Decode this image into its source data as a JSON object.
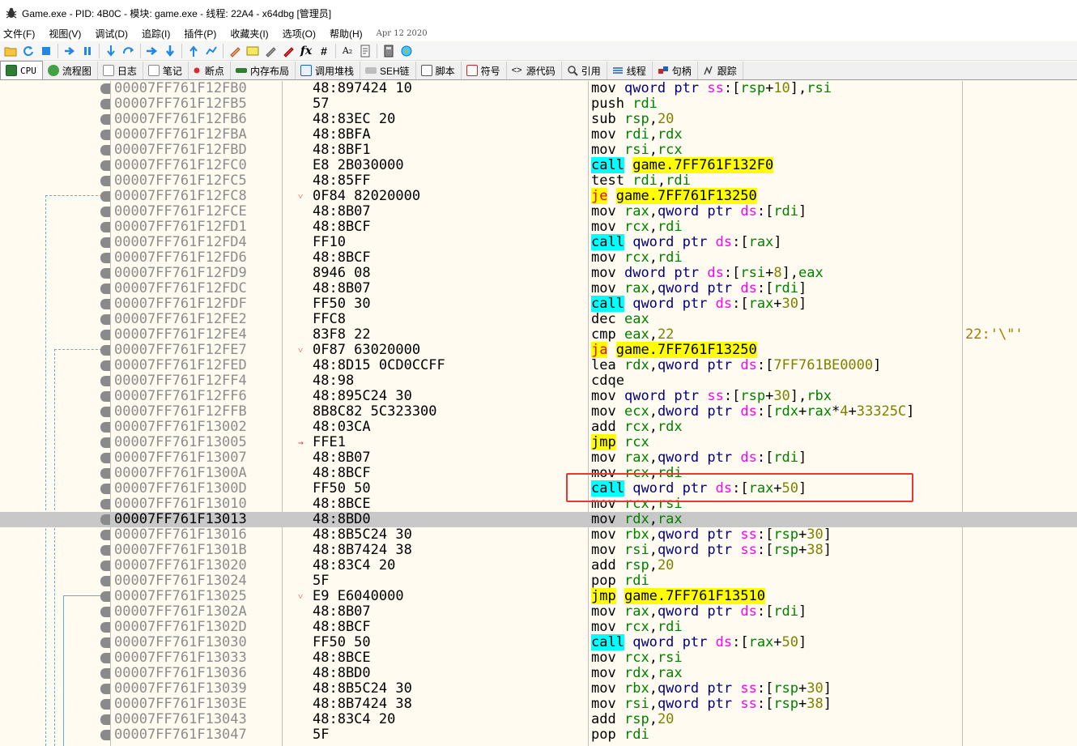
{
  "window": {
    "title": "Game.exe - PID: 4B0C - 模块: game.exe - 线程: 22A4 - x64dbg [管理员]"
  },
  "menu": {
    "items": [
      "文件(F)",
      "视图(V)",
      "调试(D)",
      "追踪(I)",
      "插件(P)",
      "收藏夹(I)",
      "选项(O)",
      "帮助(H)"
    ],
    "date": "Apr 12 2020"
  },
  "toolbar": {
    "icons": [
      "open-icon",
      "restart-icon",
      "stop-icon",
      "run-icon",
      "pause-icon",
      "step-into-icon",
      "step-over-icon",
      "trace-into-icon",
      "trace-over-icon",
      "execute-till-return-icon",
      "run-to-user-code-icon",
      "comment-icon",
      "label-icon",
      "bookmark-icon",
      "function-icon",
      "fx-icon",
      "hash-icon",
      "font-icon",
      "script-icon",
      "calculator-icon",
      "help-icon"
    ]
  },
  "tabs": [
    {
      "label": "CPU",
      "icon": "cpu-icon",
      "color": "#2e7d32",
      "active": true
    },
    {
      "label": "流程图",
      "icon": "graph-icon",
      "color": "#388e3c"
    },
    {
      "label": "日志",
      "icon": "log-icon",
      "color": "#999999"
    },
    {
      "label": "笔记",
      "icon": "notes-icon",
      "color": "#999999"
    },
    {
      "label": "断点",
      "icon": "breakpoint-icon",
      "color": "#d32f2f"
    },
    {
      "label": "内存布局",
      "icon": "memory-map-icon",
      "color": "#2e7d32"
    },
    {
      "label": "调用堆栈",
      "icon": "call-stack-icon",
      "color": "#1565c0"
    },
    {
      "label": "SEH链",
      "icon": "seh-icon",
      "color": "#666666"
    },
    {
      "label": "脚本",
      "icon": "script-icon",
      "color": "#444444"
    },
    {
      "label": "符号",
      "icon": "symbols-icon",
      "color": "#c62828"
    },
    {
      "label": "源代码",
      "icon": "source-icon",
      "color": "#444444"
    },
    {
      "label": "引用",
      "icon": "references-icon",
      "color": "#444444"
    },
    {
      "label": "线程",
      "icon": "threads-icon",
      "color": "#1565c0"
    },
    {
      "label": "句柄",
      "icon": "handles-icon",
      "color": "#c62828"
    },
    {
      "label": "跟踪",
      "icon": "trace-icon",
      "color": "#444444"
    }
  ],
  "colors": {
    "background": "#fffbf0",
    "selected_row": "#c8c8c8",
    "call_highlight": "#00ffff",
    "jump_highlight": "#ffff00",
    "annotation_box": "#e53935"
  },
  "disassembly": {
    "selected_address": "00007FF761F13013",
    "rows": [
      {
        "addr": "00007FF761F12FB0",
        "bytes": "48:897424 10",
        "asm": "mov qword ptr ss:[rsp+10],rsi"
      },
      {
        "addr": "00007FF761F12FB5",
        "bytes": "57",
        "asm": "push rdi"
      },
      {
        "addr": "00007FF761F12FB6",
        "bytes": "48:83EC 20",
        "asm": "sub rsp,20"
      },
      {
        "addr": "00007FF761F12FBA",
        "bytes": "48:8BFA",
        "asm": "mov rdi,rdx"
      },
      {
        "addr": "00007FF761F12FBD",
        "bytes": "48:8BF1",
        "asm": "mov rsi,rcx"
      },
      {
        "addr": "00007FF761F12FC0",
        "bytes": "E8 2B030000",
        "asm": "call game.7FF761F132F0"
      },
      {
        "addr": "00007FF761F12FC5",
        "bytes": "48:85FF",
        "asm": "test rdi,rdi"
      },
      {
        "addr": "00007FF761F12FC8",
        "bytes": "0F84 82020000",
        "asm": "je game.7FF761F13250",
        "mark": "˅"
      },
      {
        "addr": "00007FF761F12FCE",
        "bytes": "48:8B07",
        "asm": "mov rax,qword ptr ds:[rdi]"
      },
      {
        "addr": "00007FF761F12FD1",
        "bytes": "48:8BCF",
        "asm": "mov rcx,rdi"
      },
      {
        "addr": "00007FF761F12FD4",
        "bytes": "FF10",
        "asm": "call qword ptr ds:[rax]"
      },
      {
        "addr": "00007FF761F12FD6",
        "bytes": "48:8BCF",
        "asm": "mov rcx,rdi"
      },
      {
        "addr": "00007FF761F12FD9",
        "bytes": "8946 08",
        "asm": "mov dword ptr ds:[rsi+8],eax"
      },
      {
        "addr": "00007FF761F12FDC",
        "bytes": "48:8B07",
        "asm": "mov rax,qword ptr ds:[rdi]"
      },
      {
        "addr": "00007FF761F12FDF",
        "bytes": "FF50 30",
        "asm": "call qword ptr ds:[rax+30]"
      },
      {
        "addr": "00007FF761F12FE2",
        "bytes": "FFC8",
        "asm": "dec eax"
      },
      {
        "addr": "00007FF761F12FE4",
        "bytes": "83F8 22",
        "asm": "cmp eax,22",
        "comment": "22:'\\\"'"
      },
      {
        "addr": "00007FF761F12FE7",
        "bytes": "0F87 63020000",
        "asm": "ja game.7FF761F13250",
        "mark": "˅"
      },
      {
        "addr": "00007FF761F12FED",
        "bytes": "48:8D15 0CD0CCFF",
        "asm": "lea rdx,qword ptr ds:[7FF761BE0000]"
      },
      {
        "addr": "00007FF761F12FF4",
        "bytes": "48:98",
        "asm": "cdqe"
      },
      {
        "addr": "00007FF761F12FF6",
        "bytes": "48:895C24 30",
        "asm": "mov qword ptr ss:[rsp+30],rbx"
      },
      {
        "addr": "00007FF761F12FFB",
        "bytes": "8B8C82 5C323300",
        "asm": "mov ecx,dword ptr ds:[rdx+rax*4+33325C]"
      },
      {
        "addr": "00007FF761F13002",
        "bytes": "48:03CA",
        "asm": "add rcx,rdx"
      },
      {
        "addr": "00007FF761F13005",
        "bytes": "FFE1",
        "asm": "jmp rcx",
        "mark": "→"
      },
      {
        "addr": "00007FF761F13007",
        "bytes": "48:8B07",
        "asm": "mov rax,qword ptr ds:[rdi]"
      },
      {
        "addr": "00007FF761F1300A",
        "bytes": "48:8BCF",
        "asm": "mov rcx,rdi"
      },
      {
        "addr": "00007FF761F1300D",
        "bytes": "FF50 50",
        "asm": "call qword ptr ds:[rax+50]"
      },
      {
        "addr": "00007FF761F13010",
        "bytes": "48:8BCE",
        "asm": "mov rcx,rsi"
      },
      {
        "addr": "00007FF761F13013",
        "bytes": "48:8BD0",
        "asm": "mov rdx,rax"
      },
      {
        "addr": "00007FF761F13016",
        "bytes": "48:8B5C24 30",
        "asm": "mov rbx,qword ptr ss:[rsp+30]"
      },
      {
        "addr": "00007FF761F1301B",
        "bytes": "48:8B7424 38",
        "asm": "mov rsi,qword ptr ss:[rsp+38]"
      },
      {
        "addr": "00007FF761F13020",
        "bytes": "48:83C4 20",
        "asm": "add rsp,20"
      },
      {
        "addr": "00007FF761F13024",
        "bytes": "5F",
        "asm": "pop rdi"
      },
      {
        "addr": "00007FF761F13025",
        "bytes": "E9 E6040000",
        "asm": "jmp game.7FF761F13510",
        "mark": "˅"
      },
      {
        "addr": "00007FF761F1302A",
        "bytes": "48:8B07",
        "asm": "mov rax,qword ptr ds:[rdi]"
      },
      {
        "addr": "00007FF761F1302D",
        "bytes": "48:8BCF",
        "asm": "mov rcx,rdi"
      },
      {
        "addr": "00007FF761F13030",
        "bytes": "FF50 50",
        "asm": "call qword ptr ds:[rax+50]"
      },
      {
        "addr": "00007FF761F13033",
        "bytes": "48:8BCE",
        "asm": "mov rcx,rsi"
      },
      {
        "addr": "00007FF761F13036",
        "bytes": "48:8BD0",
        "asm": "mov rdx,rax"
      },
      {
        "addr": "00007FF761F13039",
        "bytes": "48:8B5C24 30",
        "asm": "mov rbx,qword ptr ss:[rsp+30]"
      },
      {
        "addr": "00007FF761F1303E",
        "bytes": "48:8B7424 38",
        "asm": "mov rsi,qword ptr ss:[rsp+38]"
      },
      {
        "addr": "00007FF761F13043",
        "bytes": "48:83C4 20",
        "asm": "add rsp,20"
      },
      {
        "addr": "00007FF761F13047",
        "bytes": "5F",
        "asm": "pop rdi"
      }
    ]
  }
}
